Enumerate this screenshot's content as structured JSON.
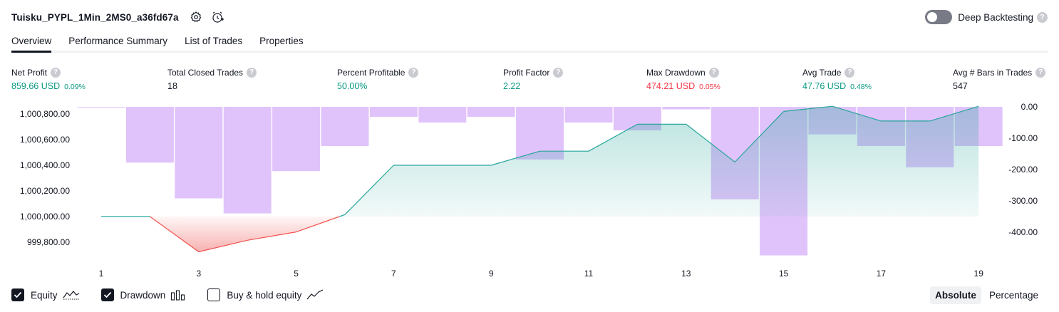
{
  "header": {
    "strategy_name": "Tuisku_PYPL_1Min_2MS0_a36fd67a",
    "settings_icon": "gear-icon",
    "alert_icon": "alarm-clock-add-icon",
    "deep_backtesting_label": "Deep Backtesting",
    "deep_backtesting_on": false,
    "help_glyph": "?"
  },
  "tabs": [
    {
      "label": "Overview",
      "active": true
    },
    {
      "label": "Performance Summary",
      "active": false
    },
    {
      "label": "List of Trades",
      "active": false
    },
    {
      "label": "Properties",
      "active": false
    }
  ],
  "stats": [
    {
      "label": "Net Profit",
      "value": "859.66 USD",
      "pct": "0.09%",
      "color": "green"
    },
    {
      "label": "Total Closed Trades",
      "value": "18",
      "pct": "",
      "color": "dark"
    },
    {
      "label": "Percent Profitable",
      "value": "50.00%",
      "pct": "",
      "color": "green"
    },
    {
      "label": "Profit Factor",
      "value": "2.22",
      "pct": "",
      "color": "green"
    },
    {
      "label": "Max Drawdown",
      "value": "474.21 USD",
      "pct": "0.05%",
      "color": "red"
    },
    {
      "label": "Avg Trade",
      "value": "47.76 USD",
      "pct": "0.48%",
      "color": "green"
    },
    {
      "label": "Avg # Bars in Trades",
      "value": "547",
      "pct": "",
      "color": "dark"
    }
  ],
  "legend": {
    "equity_label": "Equity",
    "equity_checked": true,
    "drawdown_label": "Drawdown",
    "drawdown_checked": true,
    "buyhold_label": "Buy & hold equity",
    "buyhold_checked": false
  },
  "mode": {
    "absolute_label": "Absolute",
    "percentage_label": "Percentage",
    "active": "absolute"
  },
  "colors": {
    "equity_line": "#26a69a",
    "equity_fill": "#26a69a",
    "loss_line": "#ef5350",
    "drawdown_bar": "#e1c3fb",
    "green": "#089981",
    "red": "#f23645"
  },
  "chart_data": {
    "type": "area",
    "x_ticks": [
      "1",
      "3",
      "5",
      "7",
      "9",
      "11",
      "13",
      "15",
      "17",
      "19"
    ],
    "left_axis": {
      "ticks": [
        "1,000,800.00",
        "1,000,600.00",
        "1,000,400.00",
        "1,000,200.00",
        "1,000,000.00",
        "999,800.00"
      ],
      "tick_values": [
        1000800,
        1000600,
        1000400,
        1000200,
        1000000,
        999800
      ]
    },
    "right_axis": {
      "ticks": [
        "0.00",
        "-100.00",
        "-200.00",
        "-300.00",
        "-400.00"
      ],
      "tick_values": [
        0,
        -100,
        -200,
        -300,
        -400
      ]
    },
    "series": [
      {
        "name": "Equity",
        "axis": "left",
        "baseline": 1000000,
        "x": [
          1,
          2,
          3,
          4,
          5,
          6,
          7,
          8,
          9,
          10,
          11,
          12,
          13,
          14,
          15,
          16,
          17,
          18,
          19
        ],
        "values": [
          1000000,
          1000000,
          999725,
          999815,
          999880,
          1000015,
          1000400,
          1000400,
          1000400,
          1000510,
          1000510,
          1000720,
          1000720,
          1000425,
          1000820,
          1000860,
          1000745,
          1000745,
          1000860
        ]
      },
      {
        "name": "Drawdown",
        "axis": "right",
        "x": [
          1,
          2,
          3,
          4,
          5,
          6,
          7,
          8,
          9,
          10,
          11,
          12,
          13,
          14,
          15,
          16,
          17,
          18,
          19
        ],
        "values": [
          0,
          -178,
          -292,
          -340,
          -205,
          -125,
          -32,
          -50,
          -32,
          -168,
          -50,
          -75,
          -8,
          -295,
          -474,
          -88,
          -125,
          -193,
          -125
        ]
      }
    ]
  }
}
